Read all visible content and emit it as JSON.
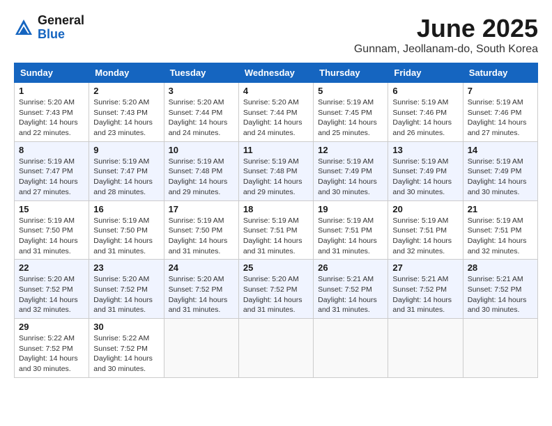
{
  "header": {
    "logo_line1": "General",
    "logo_line2": "Blue",
    "month_title": "June 2025",
    "location": "Gunnam, Jeollanam-do, South Korea"
  },
  "days_of_week": [
    "Sunday",
    "Monday",
    "Tuesday",
    "Wednesday",
    "Thursday",
    "Friday",
    "Saturday"
  ],
  "weeks": [
    [
      {
        "day": "1",
        "sunrise": "5:20 AM",
        "sunset": "7:43 PM",
        "daylight": "14 hours and 22 minutes."
      },
      {
        "day": "2",
        "sunrise": "5:20 AM",
        "sunset": "7:43 PM",
        "daylight": "14 hours and 23 minutes."
      },
      {
        "day": "3",
        "sunrise": "5:20 AM",
        "sunset": "7:44 PM",
        "daylight": "14 hours and 24 minutes."
      },
      {
        "day": "4",
        "sunrise": "5:20 AM",
        "sunset": "7:44 PM",
        "daylight": "14 hours and 24 minutes."
      },
      {
        "day": "5",
        "sunrise": "5:19 AM",
        "sunset": "7:45 PM",
        "daylight": "14 hours and 25 minutes."
      },
      {
        "day": "6",
        "sunrise": "5:19 AM",
        "sunset": "7:46 PM",
        "daylight": "14 hours and 26 minutes."
      },
      {
        "day": "7",
        "sunrise": "5:19 AM",
        "sunset": "7:46 PM",
        "daylight": "14 hours and 27 minutes."
      }
    ],
    [
      {
        "day": "8",
        "sunrise": "5:19 AM",
        "sunset": "7:47 PM",
        "daylight": "14 hours and 27 minutes."
      },
      {
        "day": "9",
        "sunrise": "5:19 AM",
        "sunset": "7:47 PM",
        "daylight": "14 hours and 28 minutes."
      },
      {
        "day": "10",
        "sunrise": "5:19 AM",
        "sunset": "7:48 PM",
        "daylight": "14 hours and 29 minutes."
      },
      {
        "day": "11",
        "sunrise": "5:19 AM",
        "sunset": "7:48 PM",
        "daylight": "14 hours and 29 minutes."
      },
      {
        "day": "12",
        "sunrise": "5:19 AM",
        "sunset": "7:49 PM",
        "daylight": "14 hours and 30 minutes."
      },
      {
        "day": "13",
        "sunrise": "5:19 AM",
        "sunset": "7:49 PM",
        "daylight": "14 hours and 30 minutes."
      },
      {
        "day": "14",
        "sunrise": "5:19 AM",
        "sunset": "7:49 PM",
        "daylight": "14 hours and 30 minutes."
      }
    ],
    [
      {
        "day": "15",
        "sunrise": "5:19 AM",
        "sunset": "7:50 PM",
        "daylight": "14 hours and 31 minutes."
      },
      {
        "day": "16",
        "sunrise": "5:19 AM",
        "sunset": "7:50 PM",
        "daylight": "14 hours and 31 minutes."
      },
      {
        "day": "17",
        "sunrise": "5:19 AM",
        "sunset": "7:50 PM",
        "daylight": "14 hours and 31 minutes."
      },
      {
        "day": "18",
        "sunrise": "5:19 AM",
        "sunset": "7:51 PM",
        "daylight": "14 hours and 31 minutes."
      },
      {
        "day": "19",
        "sunrise": "5:19 AM",
        "sunset": "7:51 PM",
        "daylight": "14 hours and 31 minutes."
      },
      {
        "day": "20",
        "sunrise": "5:19 AM",
        "sunset": "7:51 PM",
        "daylight": "14 hours and 32 minutes."
      },
      {
        "day": "21",
        "sunrise": "5:19 AM",
        "sunset": "7:51 PM",
        "daylight": "14 hours and 32 minutes."
      }
    ],
    [
      {
        "day": "22",
        "sunrise": "5:20 AM",
        "sunset": "7:52 PM",
        "daylight": "14 hours and 32 minutes."
      },
      {
        "day": "23",
        "sunrise": "5:20 AM",
        "sunset": "7:52 PM",
        "daylight": "14 hours and 31 minutes."
      },
      {
        "day": "24",
        "sunrise": "5:20 AM",
        "sunset": "7:52 PM",
        "daylight": "14 hours and 31 minutes."
      },
      {
        "day": "25",
        "sunrise": "5:20 AM",
        "sunset": "7:52 PM",
        "daylight": "14 hours and 31 minutes."
      },
      {
        "day": "26",
        "sunrise": "5:21 AM",
        "sunset": "7:52 PM",
        "daylight": "14 hours and 31 minutes."
      },
      {
        "day": "27",
        "sunrise": "5:21 AM",
        "sunset": "7:52 PM",
        "daylight": "14 hours and 31 minutes."
      },
      {
        "day": "28",
        "sunrise": "5:21 AM",
        "sunset": "7:52 PM",
        "daylight": "14 hours and 30 minutes."
      }
    ],
    [
      {
        "day": "29",
        "sunrise": "5:22 AM",
        "sunset": "7:52 PM",
        "daylight": "14 hours and 30 minutes."
      },
      {
        "day": "30",
        "sunrise": "5:22 AM",
        "sunset": "7:52 PM",
        "daylight": "14 hours and 30 minutes."
      },
      null,
      null,
      null,
      null,
      null
    ]
  ],
  "labels": {
    "sunrise": "Sunrise:",
    "sunset": "Sunset:",
    "daylight": "Daylight:"
  }
}
